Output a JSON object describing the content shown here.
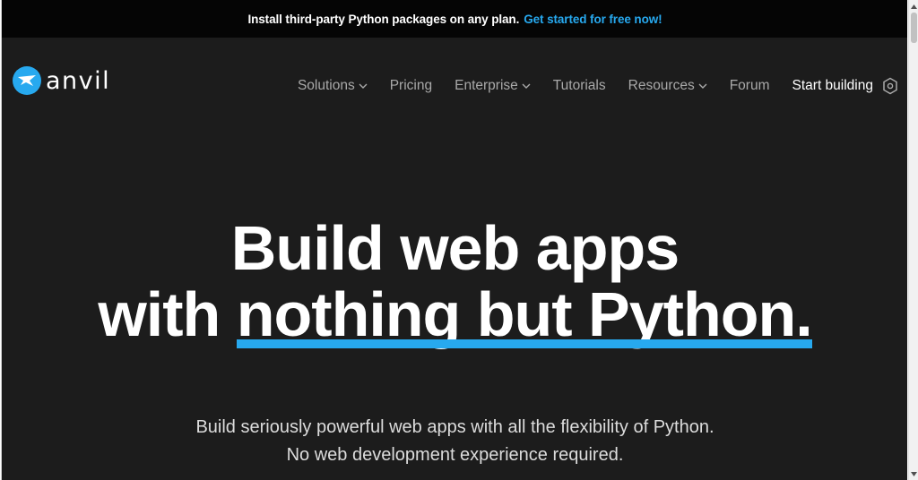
{
  "banner": {
    "text": "Install third-party Python packages on any plan.",
    "cta": "Get started for free now!"
  },
  "logo": {
    "text": "anvil",
    "icon": "anvil-logo-icon"
  },
  "nav": {
    "items": [
      {
        "label": "Solutions",
        "dropdown": true
      },
      {
        "label": "Pricing",
        "dropdown": false
      },
      {
        "label": "Enterprise",
        "dropdown": true
      },
      {
        "label": "Tutorials",
        "dropdown": false
      },
      {
        "label": "Resources",
        "dropdown": true
      },
      {
        "label": "Forum",
        "dropdown": false
      }
    ],
    "start_building": "Start building",
    "start_icon": "hexagon-icon"
  },
  "hero": {
    "line1": "Build web apps",
    "line2_prefix": "with ",
    "line2_highlight": "nothing but Python."
  },
  "subtitle": {
    "line1": "Build seriously powerful web apps with all the flexibility of Python.",
    "line2": "No web development experience required."
  },
  "colors": {
    "accent": "#27a9ef",
    "background": "#1c1c1c",
    "banner": "#050505"
  }
}
